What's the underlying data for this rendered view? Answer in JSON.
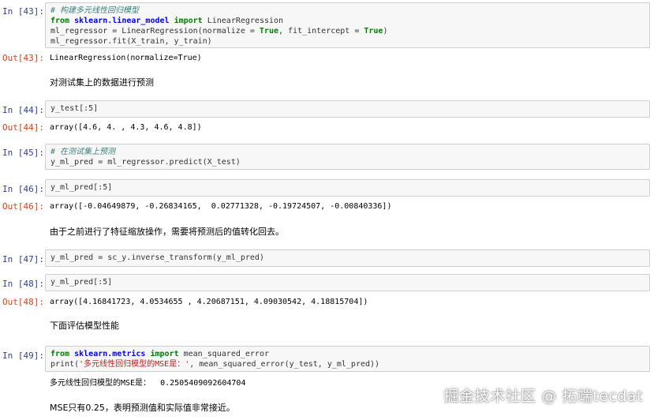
{
  "cells": {
    "c43": {
      "in_prompt": "In  [43]:",
      "comment": "# 构建多元线性回归模型",
      "kw_from": "from",
      "module": "sklearn.linear_model",
      "kw_import": "import",
      "import_name": " LinearRegression",
      "line2_a": "ml_regressor = LinearRegression(normalize = ",
      "true1": "True",
      "line2_b": ", fit_intercept = ",
      "true2": "True",
      "line2_c": ")",
      "line3": "ml_regressor.fit(X_train, y_train)",
      "out_prompt": "Out[43]:",
      "output": "LinearRegression(normalize=True)"
    },
    "md1": "对测试集上的数据进行预测",
    "c44": {
      "in_prompt": "In  [44]:",
      "code": "y_test[:5]",
      "out_prompt": "Out[44]:",
      "output": "array([4.6, 4. , 4.3, 4.6, 4.8])"
    },
    "c45": {
      "in_prompt": "In  [45]:",
      "comment": "# 在测试集上预测",
      "code": "y_ml_pred = ml_regressor.predict(X_test)"
    },
    "c46": {
      "in_prompt": "In  [46]:",
      "code": "y_ml_pred[:5]",
      "out_prompt": "Out[46]:",
      "output": "array([-0.04649879, -0.26834165,  0.02771328, -0.19724507, -0.00840336])"
    },
    "md2": "由于之前进行了特征缩放操作，需要将预测后的值转化回去。",
    "c47": {
      "in_prompt": "In  [47]:",
      "code": "y_ml_pred = sc_y.inverse_transform(y_ml_pred)"
    },
    "c48": {
      "in_prompt": "In  [48]:",
      "code": "y_ml_pred[:5]",
      "out_prompt": "Out[48]:",
      "output": "array([4.16841723, 4.0534655 , 4.20687151, 4.09030542, 4.18815704])"
    },
    "md3": "下面评估模型性能",
    "c49": {
      "in_prompt": "In  [49]:",
      "kw_from": "from",
      "module": "sklearn.metrics",
      "kw_import": "import",
      "import_name": " mean_squared_error",
      "print_a": "print(",
      "print_str": "'多元线性回归模型的MSE是：'",
      "print_b": ", mean_squared_error(y_test, y_ml_pred))",
      "output": "多元线性回归模型的MSE是：  0.2505409092604704"
    },
    "md4": "MSE只有0.25，表明预测值和实际值非常接近。"
  },
  "watermark": "掘金技术社区 @ 拓端tecdat"
}
